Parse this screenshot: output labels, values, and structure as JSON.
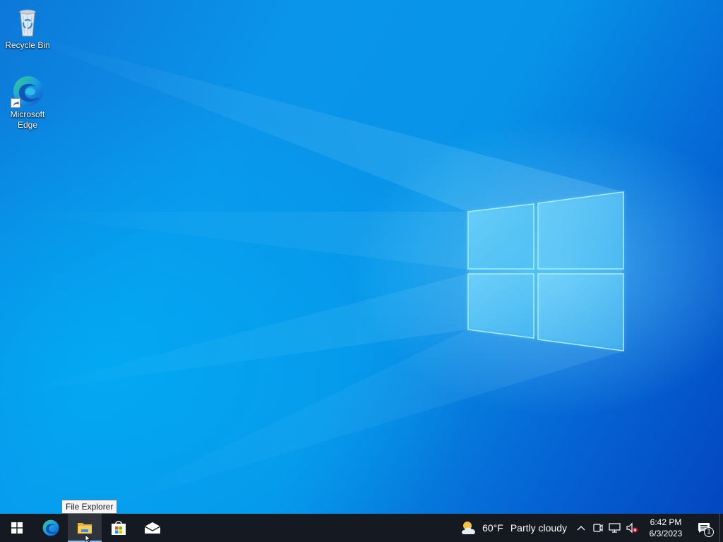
{
  "desktop": {
    "icons": [
      {
        "label": "Recycle Bin",
        "icon": "recycle-bin-icon"
      },
      {
        "label": "Microsoft\nEdge",
        "icon": "edge-icon"
      }
    ]
  },
  "tooltip": {
    "text": "File Explorer"
  },
  "taskbar": {
    "start": {
      "icon": "windows-start-icon"
    },
    "pinned": [
      {
        "name": "Microsoft Edge",
        "icon": "edge-icon"
      },
      {
        "name": "File Explorer",
        "icon": "file-explorer-icon"
      },
      {
        "name": "Microsoft Store",
        "icon": "store-icon"
      },
      {
        "name": "Mail",
        "icon": "mail-icon"
      }
    ],
    "weather": {
      "temp": "60°F",
      "desc": "Partly cloudy",
      "icon": "partly-cloudy-icon"
    },
    "tray": {
      "icons": [
        "chevron-up-icon",
        "meet-now-icon",
        "network-icon",
        "volume-muted-icon"
      ]
    },
    "clock": {
      "time": "6:42 PM",
      "date": "6/3/2023"
    },
    "notifications": {
      "count": "1",
      "icon": "action-center-icon"
    }
  },
  "colors": {
    "taskbar": "#141922",
    "accent": "#0a95ea",
    "logo_glow": "#7ee6ff"
  }
}
